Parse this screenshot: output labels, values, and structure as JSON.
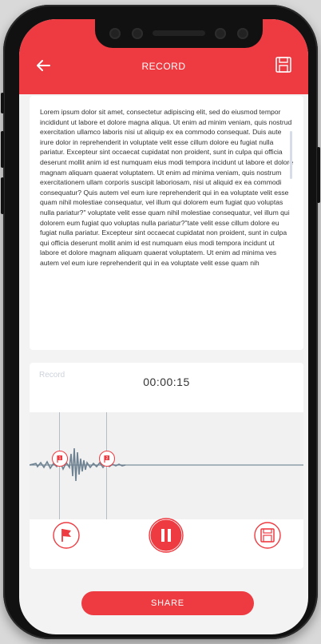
{
  "header": {
    "title": "RECORD",
    "back_icon": "arrow-left-icon",
    "save_icon": "floppy-disk-icon",
    "accent_color": "#ee3b41"
  },
  "transcript": {
    "text": "Lorem ipsum dolor sit amet, consectetur adipiscing elit, sed do eiusmod tempor incididunt ut labore et dolore magna aliqua. Ut enim ad minim veniam, quis nostrud exercitation ullamco laboris nisi ut aliquip ex ea commodo consequat. Duis aute irure dolor in reprehenderit in voluptate velit esse cillum dolore eu fugiat nulla pariatur. Excepteur sint occaecat cupidatat non proident, sunt in culpa qui officia deserunt mollit anim id est numquam eius modi tempora incidunt ut labore et dolore magnam aliquam quaerat voluptatem. Ut enim ad minima veniam, quis nostrum exercitationem ullam corporis suscipit laboriosam, nisi ut aliquid ex ea commodi consequatur? Quis autem vel eum iure reprehenderit qui in ea voluptate velit esse quam nihil molestiae consequatur, vel illum qui dolorem eum fugiat quo voluptas nulla pariatur?\" voluptate velit esse quam nihil molestiae consequatur, vel illum qui dolorem eum fugiat quo voluptas nulla pariatur?\"tate velit esse cillum dolore eu fugiat nulla pariatur. Excepteur sint occaecat cupidatat non proident, sunt in culpa qui officia deserunt mollit anim id est numquam eius modi tempora incidunt ut labore et dolore magnam aliquam quaerat voluptatem. Ut enim ad minima ves autem vel eum iure reprehenderit qui in ea voluptate velit esse quam nih"
  },
  "recorder": {
    "label": "Record",
    "elapsed": "00:00:15",
    "markers": [
      {
        "label": "1"
      },
      {
        "label": "2"
      }
    ],
    "controls": {
      "flag_icon": "flag-icon",
      "pause_icon": "pause-icon",
      "save_icon": "floppy-disk-icon"
    }
  },
  "footer": {
    "share_label": "SHARE"
  }
}
